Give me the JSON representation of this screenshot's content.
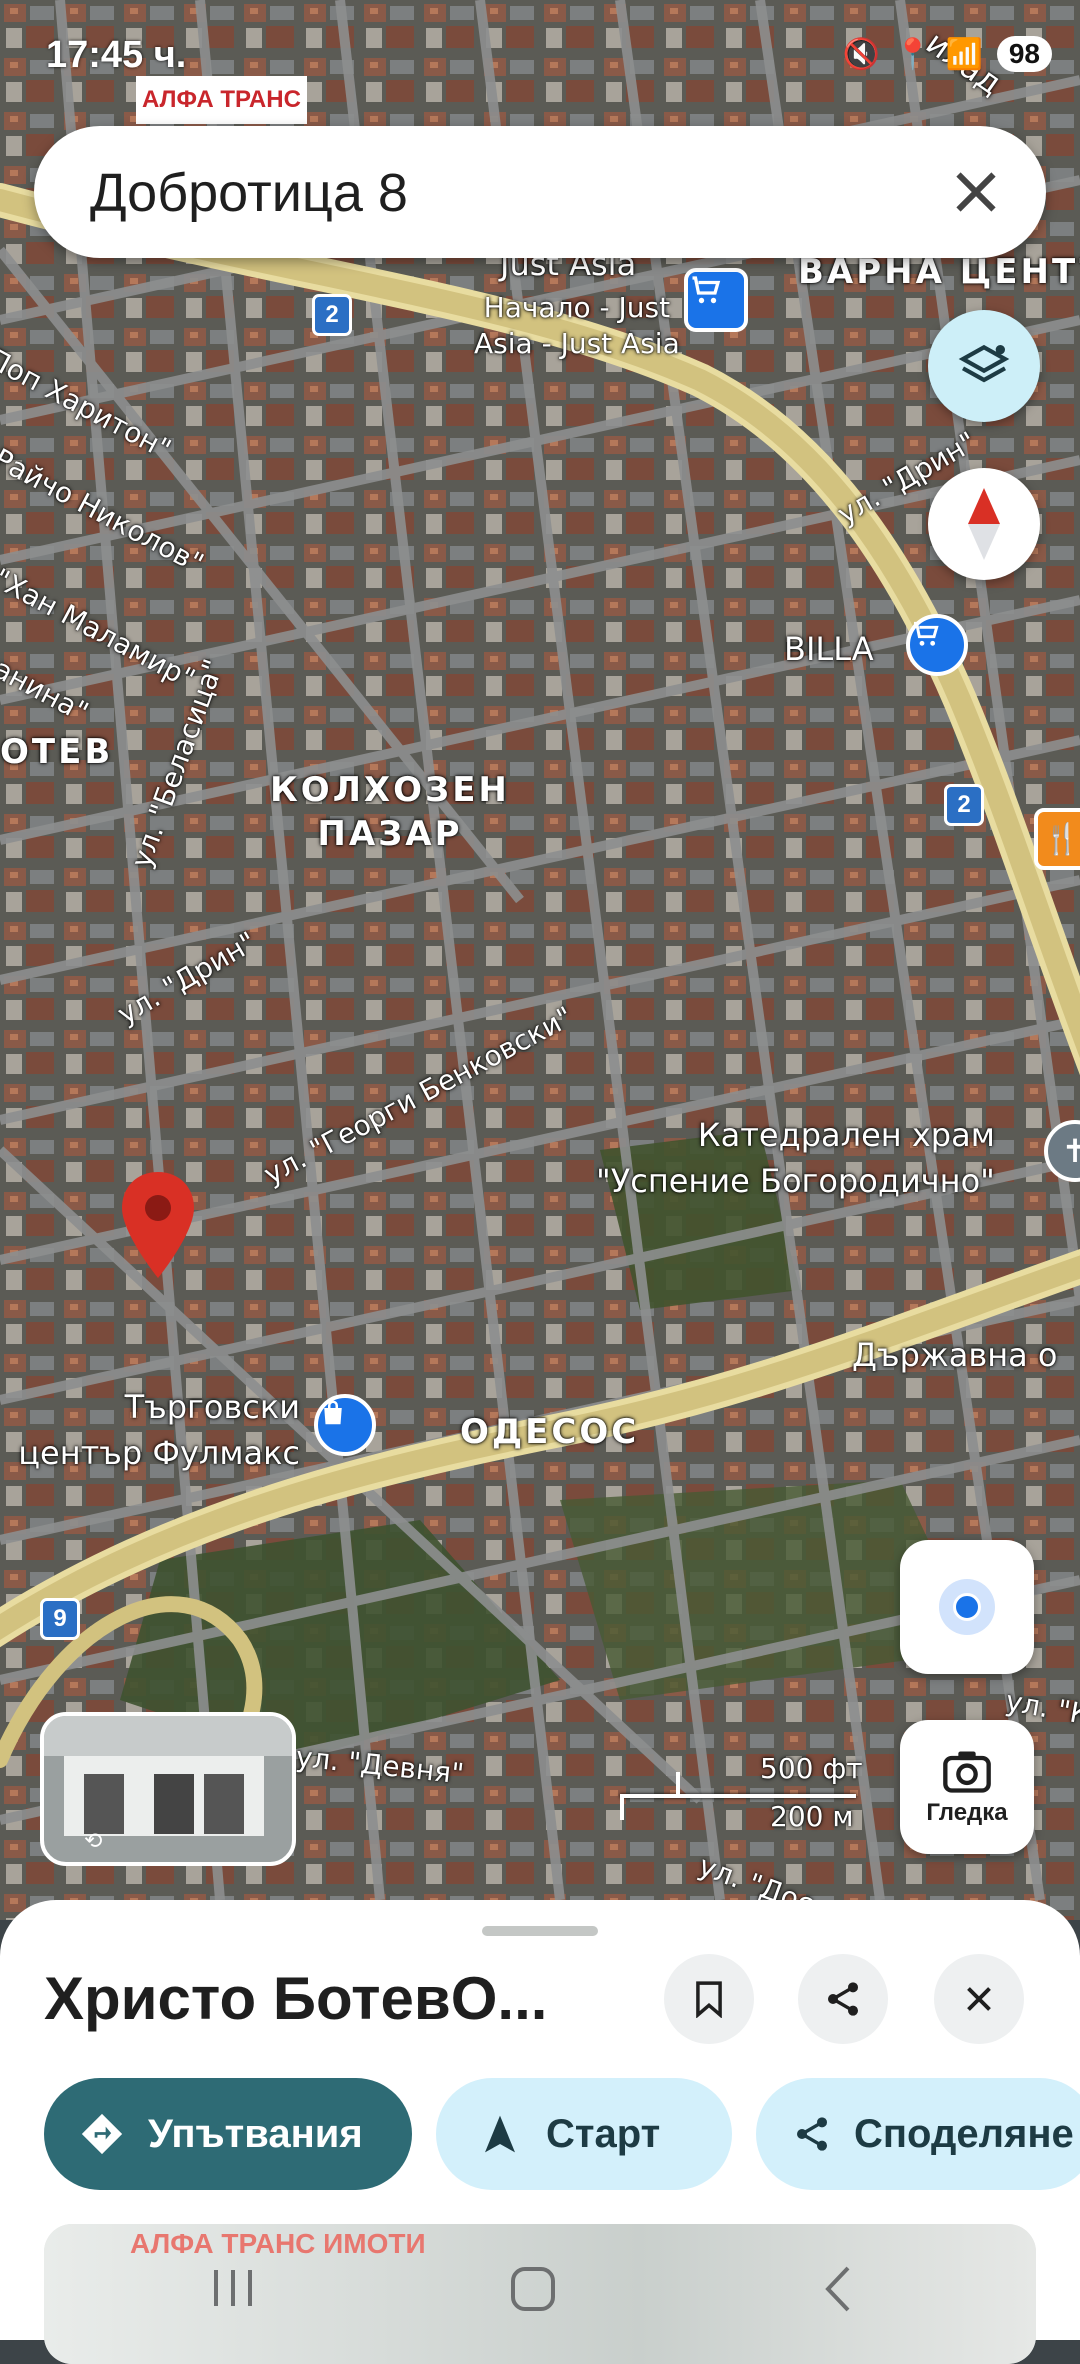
{
  "status_bar": {
    "time": "17:45 ч.",
    "battery": "98"
  },
  "watermark": {
    "logo_text": "АЛФА ТРАНС",
    "bottom_text": "АЛФА ТРАНС ИМОТИ"
  },
  "search": {
    "query": "Добротица 8"
  },
  "map": {
    "districts": {
      "center": "ВАРНА ЦЕНТЪ",
      "market": "КОЛХОЗЕН\nПАЗАР",
      "odesos": "ОДЕСОС",
      "botev": "ОТЕВ"
    },
    "streets": {
      "pop_hariton": "Поп Харитон\"",
      "raycho": "Райчо Николов\"",
      "han": "\"Хан Маламир\"",
      "nina": "анина\"",
      "belasitsa": "ул. \"Беласица\"",
      "drin_left": "ул. \"Дрин\"",
      "drin_right": "ул. \"Дрин\"",
      "benkovski": "ул. \"Георги Бенковски\"",
      "devnya": "ул. \"Девня\"",
      "k": "ул. \"К",
      "dos": "ул. \"Дос",
      "top": "илад"
    },
    "pois": {
      "justasia": "Just Asia",
      "justasia_sub": "Начало - Just\nAsia - Just Asia",
      "billa": "BILLA",
      "cathedral": "Катедрален храм\n\"Успение Богородично\"",
      "state": "Държавна о",
      "mall": "Търговски\nцентър Фулмакс"
    },
    "route_badges": [
      "2",
      "2",
      "9"
    ],
    "scale": {
      "imperial": "500 фт",
      "metric": "200 м"
    },
    "streetview_button": "Гледка"
  },
  "place": {
    "title": "Христо БотевО..."
  },
  "actions": {
    "directions": "Упътвания",
    "start": "Старт",
    "share": "Споделяне"
  },
  "colors": {
    "teal": "#2e6b75",
    "chip_bg": "#d3f0fb",
    "pin": "#d93025",
    "road": "#d7c98a"
  }
}
